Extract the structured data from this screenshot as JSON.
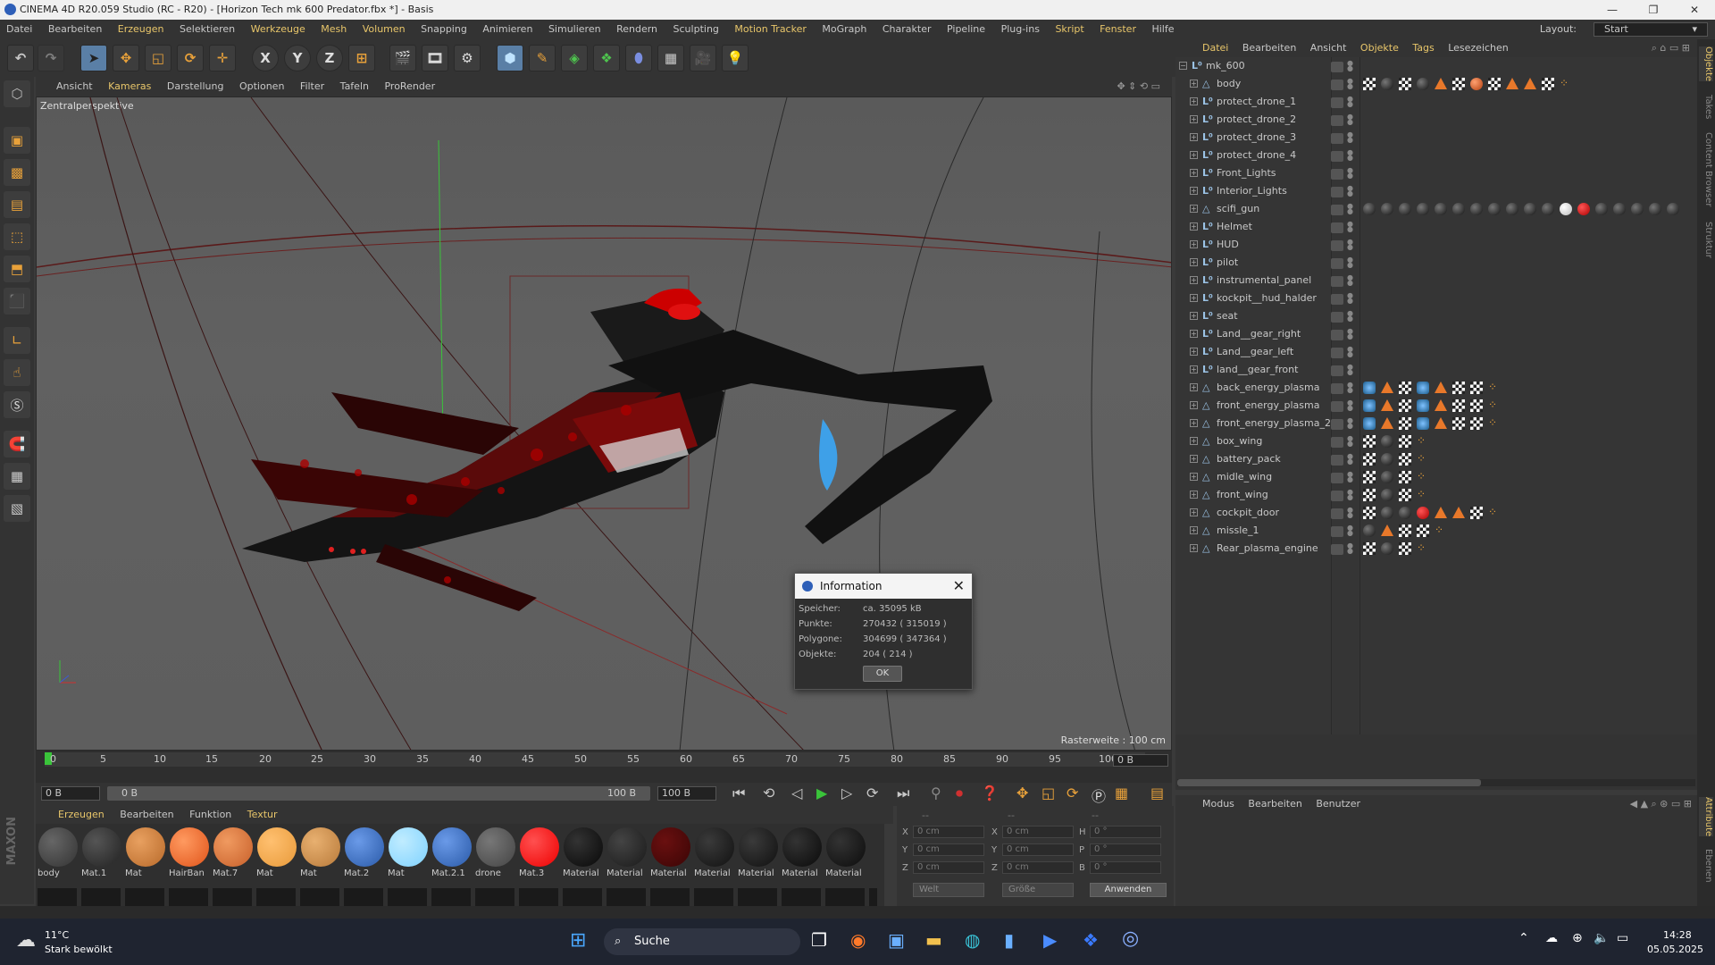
{
  "titlebar": {
    "title": "CINEMA 4D R20.059 Studio (RC - R20) - [Horizon Tech mk 600 Predator.fbx *] - Basis",
    "minimize": "—",
    "maximize": "❐",
    "close": "✕"
  },
  "menubar": {
    "items": [
      "Datei",
      "Bearbeiten",
      "Erzeugen",
      "Selektieren",
      "Werkzeuge",
      "Mesh",
      "Volumen",
      "Snapping",
      "Animieren",
      "Simulieren",
      "Rendern",
      "Sculpting",
      "Motion Tracker",
      "MoGraph",
      "Charakter",
      "Pipeline",
      "Plug-ins",
      "Skript",
      "Fenster",
      "Hilfe"
    ],
    "layout_label": "Layout:",
    "layout_value": "Start"
  },
  "toolbar": {
    "x_label": "X",
    "y_label": "Y",
    "z_label": "Z"
  },
  "viewport": {
    "menu": [
      "Ansicht",
      "Kameras",
      "Darstellung",
      "Optionen",
      "Filter",
      "Tafeln",
      "ProRender"
    ],
    "camera_label": "Zentralperspektive",
    "grid_label": "Rasterweite : 100 cm"
  },
  "timeline": {
    "ticks": [
      "0",
      "5",
      "10",
      "15",
      "20",
      "25",
      "30",
      "35",
      "40",
      "45",
      "50",
      "55",
      "60",
      "65",
      "70",
      "75",
      "80",
      "85",
      "90",
      "95",
      "100"
    ],
    "current_frame_field": "0 B",
    "start_field": "0 B",
    "range_start": "0 B",
    "range_end": "100 B",
    "end_field": "100 B"
  },
  "materials": {
    "menu": [
      "Erzeugen",
      "Bearbeiten",
      "Funktion",
      "Textur"
    ],
    "items": [
      {
        "name": "body",
        "color": "#333"
      },
      {
        "name": "Mat.1",
        "color": "#222"
      },
      {
        "name": "Mat",
        "color": "#b86a2a"
      },
      {
        "name": "HairBan",
        "color": "#e0541a"
      },
      {
        "name": "Mat.7",
        "color": "#c8602a"
      },
      {
        "name": "Mat",
        "color": "#e89a3a"
      },
      {
        "name": "Mat",
        "color": "#b87a3a"
      },
      {
        "name": "Mat.2",
        "color": "#2a5aa8"
      },
      {
        "name": "Mat",
        "color": "#7fd2ff"
      },
      {
        "name": "Mat.2.1",
        "color": "#2a5aa8"
      },
      {
        "name": "drone",
        "color": "#444"
      },
      {
        "name": "Mat.3",
        "color": "#ee0000"
      },
      {
        "name": "Material",
        "color": "#080808"
      },
      {
        "name": "Material",
        "color": "#1a1a1a"
      },
      {
        "name": "Material",
        "color": "#3a0505"
      },
      {
        "name": "Material",
        "color": "#111"
      },
      {
        "name": "Material",
        "color": "#101010"
      },
      {
        "name": "Material",
        "color": "#0a0a0a"
      },
      {
        "name": "Material",
        "color": "#0c0c0c"
      }
    ]
  },
  "coords": {
    "headers": [
      "--",
      "--",
      "--"
    ],
    "rows": [
      {
        "a": "X",
        "av": "0 cm",
        "b": "X",
        "bv": "0 cm",
        "c": "H",
        "cv": "0 °"
      },
      {
        "a": "Y",
        "av": "0 cm",
        "b": "Y",
        "bv": "0 cm",
        "c": "P",
        "cv": "0 °"
      },
      {
        "a": "Z",
        "av": "0 cm",
        "b": "Z",
        "bv": "0 cm",
        "c": "B",
        "cv": "0 °"
      }
    ],
    "world": "Welt",
    "size": "Größe",
    "apply": "Anwenden"
  },
  "object_manager": {
    "menu": [
      "Datei",
      "Bearbeiten",
      "Ansicht",
      "Objekte",
      "Tags",
      "Lesezeichen"
    ],
    "root": "mk_600",
    "objects": [
      {
        "name": "body",
        "type": "poly",
        "tags": [
          "chk",
          "sph",
          "chk",
          "sph",
          "tri",
          "chk",
          "org",
          "chk",
          "tri",
          "tri",
          "chk",
          "dts"
        ]
      },
      {
        "name": "protect_drone_1",
        "type": "null",
        "tags": []
      },
      {
        "name": "protect_drone_2",
        "type": "null",
        "tags": []
      },
      {
        "name": "protect_drone_3",
        "type": "null",
        "tags": []
      },
      {
        "name": "protect_drone_4",
        "type": "null",
        "tags": []
      },
      {
        "name": "Front_Lights",
        "type": "null",
        "tags": []
      },
      {
        "name": "Interior_Lights",
        "type": "null",
        "tags": []
      },
      {
        "name": "scifi_gun",
        "type": "poly",
        "tags": [
          "sph",
          "sph",
          "sph",
          "sph",
          "sph",
          "sph",
          "sph",
          "sph",
          "sph",
          "sph",
          "sph",
          "wht",
          "red",
          "sph",
          "sph",
          "sph",
          "sph",
          "sph"
        ]
      },
      {
        "name": "Helmet",
        "type": "null",
        "tags": []
      },
      {
        "name": "HUD",
        "type": "null",
        "tags": []
      },
      {
        "name": "pilot",
        "type": "null",
        "tags": []
      },
      {
        "name": "instrumental_panel",
        "type": "null",
        "tags": []
      },
      {
        "name": "kockpit__hud_halder",
        "type": "null",
        "tags": []
      },
      {
        "name": "seat",
        "type": "null",
        "tags": []
      },
      {
        "name": "Land__gear_right",
        "type": "null",
        "tags": []
      },
      {
        "name": "Land__gear_left",
        "type": "null",
        "tags": []
      },
      {
        "name": "land__gear_front",
        "type": "null",
        "tags": []
      },
      {
        "name": "back_energy_plasma",
        "type": "poly",
        "tags": [
          "blu",
          "tri",
          "chk",
          "blu",
          "tri",
          "chk",
          "chk",
          "dts"
        ]
      },
      {
        "name": "front_energy_plasma",
        "type": "poly",
        "tags": [
          "blu",
          "tri",
          "chk",
          "blu",
          "tri",
          "chk",
          "chk",
          "dts"
        ]
      },
      {
        "name": "front_energy_plasma_2",
        "type": "poly",
        "tags": [
          "blu",
          "tri",
          "chk",
          "blu",
          "tri",
          "chk",
          "chk",
          "dts"
        ]
      },
      {
        "name": "box_wing",
        "type": "poly",
        "tags": [
          "chk",
          "sph",
          "chk",
          "dts"
        ]
      },
      {
        "name": "battery_pack",
        "type": "poly",
        "tags": [
          "chk",
          "sph",
          "chk",
          "dts"
        ]
      },
      {
        "name": "midle_wing",
        "type": "poly",
        "tags": [
          "chk",
          "sph",
          "chk",
          "dts"
        ]
      },
      {
        "name": "front_wing",
        "type": "poly",
        "tags": [
          "chk",
          "sph",
          "chk",
          "dts"
        ]
      },
      {
        "name": "cockpit_door",
        "type": "poly",
        "tags": [
          "chk",
          "sph",
          "sph",
          "red",
          "tri",
          "tri",
          "chk",
          "dts"
        ]
      },
      {
        "name": "missle_1",
        "type": "poly",
        "tags": [
          "sph",
          "tri",
          "chk",
          "chk",
          "dts"
        ]
      },
      {
        "name": "Rear_plasma_engine",
        "type": "poly",
        "tags": [
          "chk",
          "sph",
          "chk",
          "dts"
        ]
      }
    ]
  },
  "attribute_manager": {
    "menu": [
      "Modus",
      "Bearbeiten",
      "Benutzer"
    ]
  },
  "side_tabs": [
    "Objekte",
    "Takes",
    "Content Browser",
    "Struktur",
    "Attribute",
    "Ebenen"
  ],
  "dialog": {
    "title": "Information",
    "rows": [
      {
        "label": "Speicher:",
        "value": "ca. 35095 kB"
      },
      {
        "label": "Punkte:",
        "value": "270432 ( 315019 )"
      },
      {
        "label": "Polygone:",
        "value": "304699 ( 347364 )"
      },
      {
        "label": "Objekte:",
        "value": "204 ( 214 )"
      }
    ],
    "ok": "OK"
  },
  "taskbar": {
    "weather_temp": "11°C",
    "weather_desc": "Stark bewölkt",
    "search_label": "Suche",
    "time": "14:28",
    "date": "05.05.2025"
  }
}
